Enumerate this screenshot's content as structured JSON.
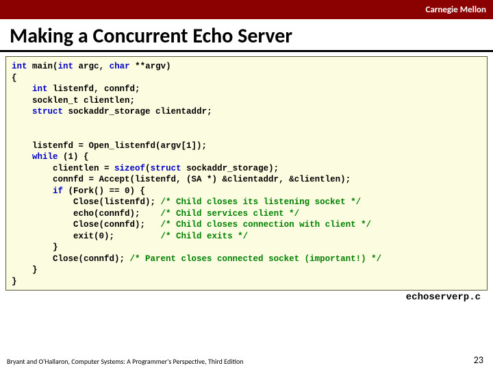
{
  "header": {
    "brand": "Carnegie Mellon"
  },
  "title": "Making a Concurrent Echo Server",
  "code": {
    "l1_a": "int",
    "l1_b": " main(",
    "l1_c": "int",
    "l1_d": " argc, ",
    "l1_e": "char",
    "l1_f": " **argv)",
    "l2": "{",
    "l3_a": "    ",
    "l3_b": "int",
    "l3_c": " listenfd, connfd;",
    "l4": "    socklen_t clientlen;",
    "l5_a": "    ",
    "l5_b": "struct",
    "l5_c": " sockaddr_storage clientaddr;",
    "blank": " ",
    "l7": "    listenfd = Open_listenfd(argv[1]);",
    "l8_a": "    ",
    "l8_b": "while",
    "l8_c": " (1) {",
    "l9_a": "        clientlen = ",
    "l9_b": "sizeof",
    "l9_c": "(",
    "l9_d": "struct",
    "l9_e": " sockaddr_storage);",
    "l10": "        connfd = Accept(listenfd, (SA *) &clientaddr, &clientlen);",
    "l11_a": "        ",
    "l11_b": "if",
    "l11_c": " (Fork() == 0) {",
    "l12_a": "            Close(listenfd); ",
    "l12_b": "/* Child closes its listening socket */",
    "l13_a": "            echo(connfd);    ",
    "l13_b": "/* Child services client */",
    "l14_a": "            Close(connfd);   ",
    "l14_b": "/* Child closes connection with client */",
    "l15_a": "            exit(0);         ",
    "l15_b": "/* Child exits */",
    "l16": "        }",
    "l17_a": "        Close(connfd); ",
    "l17_b": "/* Parent closes connected socket (important!) */",
    "l18": "    }",
    "l19": "}"
  },
  "filename": "echoserverp.c",
  "footer": {
    "left": "Bryant and O'Hallaron, Computer Systems: A Programmer's Perspective, Third Edition",
    "page": "23"
  }
}
